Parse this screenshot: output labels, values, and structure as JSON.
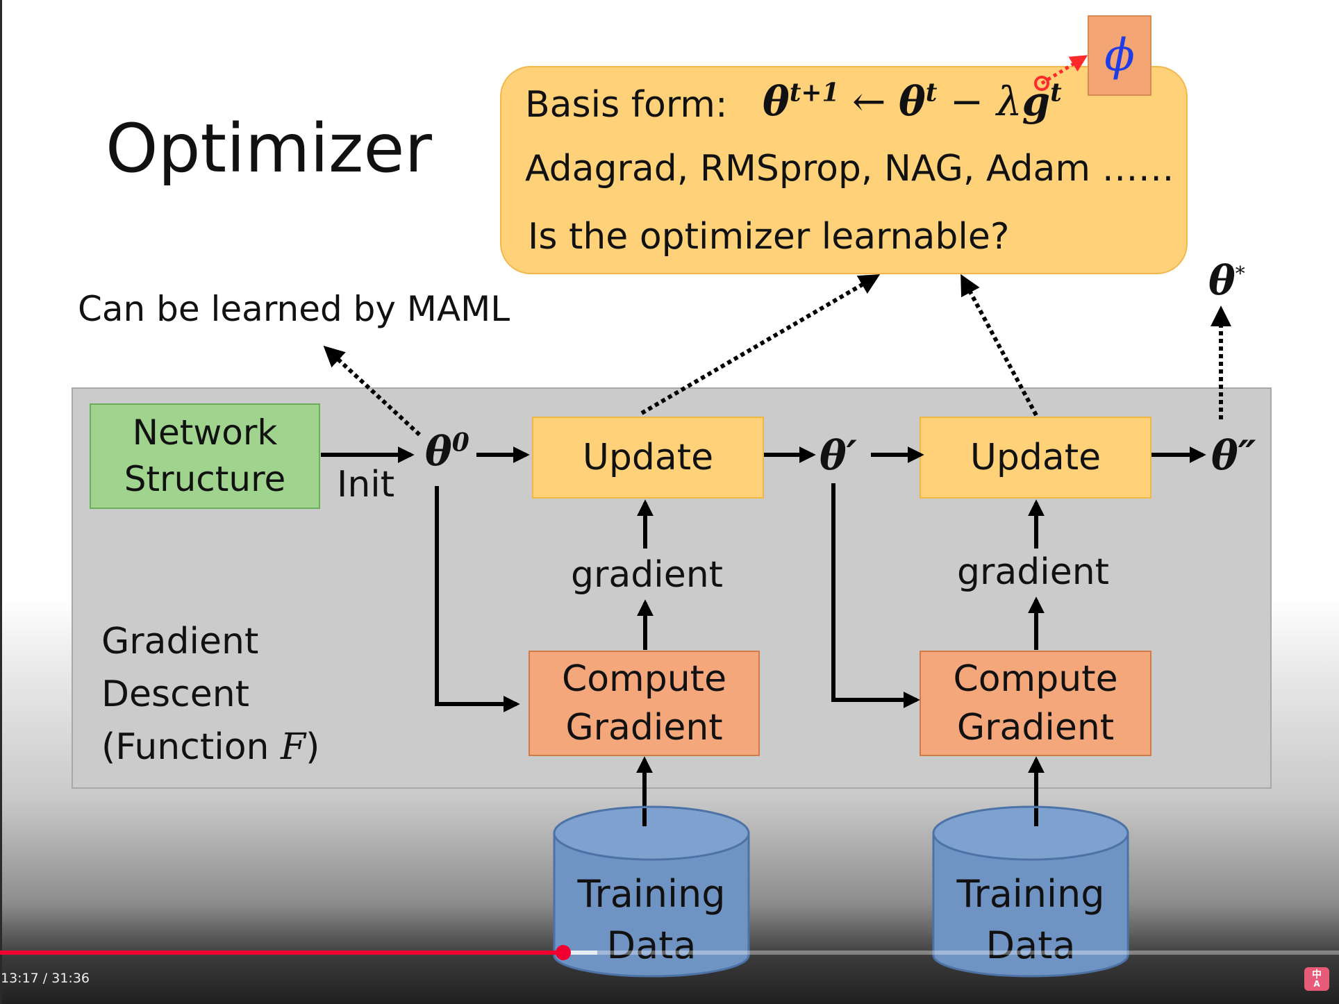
{
  "slide": {
    "title": "Optimizer",
    "formula_card": {
      "basis_label": "Basis form:",
      "optimizers_line": "Adagrad, RMSprop, NAG, Adam ……",
      "question": "Is the optimizer learnable?"
    },
    "phi_symbol": "ϕ",
    "maml_note": "Can be learned by MAML",
    "theta_star": "θ",
    "network_box": {
      "line1": "Network",
      "line2": "Structure"
    },
    "init_label": "Init",
    "theta0": "θ",
    "theta0_sup": "0",
    "theta1": "θ′",
    "theta2": "θ″",
    "update_label": "Update",
    "gradient_label": "gradient",
    "compute_box": {
      "line1": "Compute",
      "line2": "Gradient"
    },
    "gd_label": {
      "line1": "Gradient",
      "line2": "Descent",
      "line3_prefix": "(Function ",
      "line3_var": "F",
      "line3_suffix": ")"
    },
    "training_data": {
      "line1": "Training",
      "line2": "Data"
    }
  },
  "player": {
    "time_display": "13:17 / 31:36",
    "played_fraction": 0.4205,
    "subtitle_icon": "translate-subtitles-icon",
    "subtitle_glyph_top": "中",
    "subtitle_glyph_bottom": "A",
    "colors": {
      "progress": "#f00030",
      "formula_card": "#ffd279",
      "update_box": "#ffd279",
      "compute_box": "#f4a77b",
      "network_box": "#9fd38e",
      "phi_box": "#f4a574",
      "cylinder": "#6f93c3"
    }
  }
}
